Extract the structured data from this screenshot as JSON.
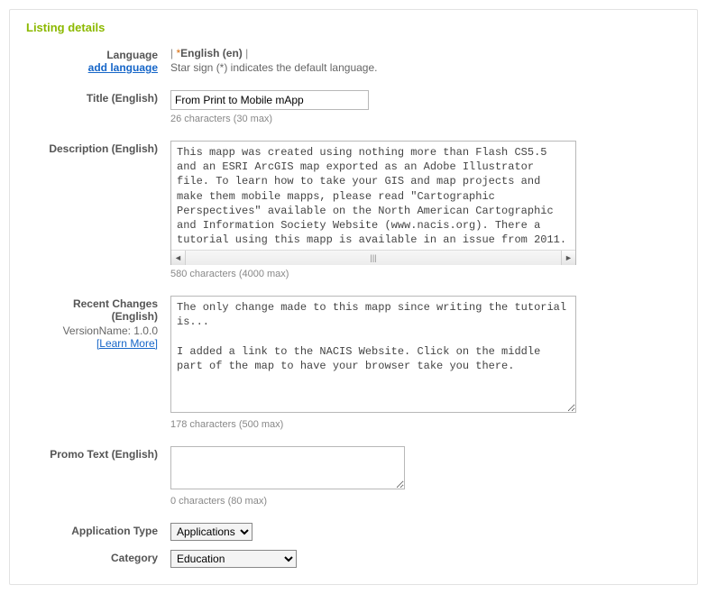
{
  "section_title": "Listing details",
  "language": {
    "label": "Language",
    "add_link": "add language",
    "current": "English (en)",
    "hint": "Star sign (*) indicates the default language."
  },
  "title": {
    "label": "Title (English)",
    "value": "From Print to Mobile mApp",
    "counter": "26 characters (30 max)"
  },
  "description": {
    "label": "Description (English)",
    "value": "This mapp was created using nothing more than Flash CS5.5 and an ESRI ArcGIS map exported as an Adobe Illustrator file. To learn how to take your GIS and map projects and make them mobile mapps, please read \"Cartographic Perspectives\" available on the North American Cartographic and Information Society Website (www.nacis.org). There a tutorial using this mapp is available in an issue from 2011.",
    "counter": "580 characters (4000 max)"
  },
  "recent": {
    "label": "Recent Changes (English)",
    "version_line": "VersionName: 1.0.0",
    "learn_more": "[Learn More]",
    "value": "The only change made to this mapp since writing the tutorial is...\n\nI added a link to the NACIS Website. Click on the middle part of the map to have your browser take you there.",
    "counter": "178 characters (500 max)"
  },
  "promo": {
    "label": "Promo Text (English)",
    "value": "",
    "counter": "0 characters (80 max)"
  },
  "app_type": {
    "label": "Application Type",
    "value": "Applications"
  },
  "category": {
    "label": "Category",
    "value": "Education"
  }
}
